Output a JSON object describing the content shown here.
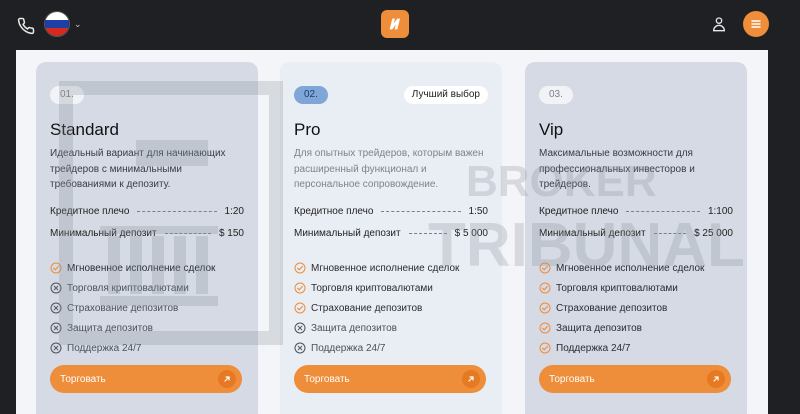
{
  "header": {
    "phone_icon": "phone-icon",
    "language_flag": "russia-flag-icon",
    "logo_icon": "broker-logo-icon",
    "user_icon": "user-icon",
    "menu_icon": "hamburger-menu-icon",
    "accent_color": "#ee8d3a"
  },
  "plans": [
    {
      "number": "01.",
      "title": "Standard",
      "description": "Идеальный вариант для начинающих трейдеров с минимальными требованиями к депозиту.",
      "specs": [
        {
          "label": "Кредитное плечо",
          "value": "1:20"
        },
        {
          "label": "Минимальный депозит",
          "value": "$ 150"
        }
      ],
      "features": [
        {
          "label": "Мгновенное исполнение сделок",
          "included": true
        },
        {
          "label": "Торговля криптовалютами",
          "included": false
        },
        {
          "label": "Страхование депозитов",
          "included": false
        },
        {
          "label": "Защита депозитов",
          "included": false
        },
        {
          "label": "Поддержка 24/7",
          "included": false
        }
      ],
      "button": "Торговать"
    },
    {
      "number": "02.",
      "badge": "Лучший выбор",
      "title": "Pro",
      "description": "Для опытных трейдеров, которым важен расширенный функционал и персональное сопровождение.",
      "specs": [
        {
          "label": "Кредитное плечо",
          "value": "1:50"
        },
        {
          "label": "Минимальный депозит",
          "value": "$ 5 000"
        }
      ],
      "features": [
        {
          "label": "Мгновенное исполнение сделок",
          "included": true
        },
        {
          "label": "Торговля криптовалютами",
          "included": true
        },
        {
          "label": "Страхование депозитов",
          "included": true
        },
        {
          "label": "Защита депозитов",
          "included": false
        },
        {
          "label": "Поддержка 24/7",
          "included": false
        }
      ],
      "button": "Торговать"
    },
    {
      "number": "03.",
      "title": "Vip",
      "description": "Максимальные возможности для профессиональных инвесторов и трейдеров.",
      "specs": [
        {
          "label": "Кредитное плечо",
          "value": "1:100"
        },
        {
          "label": "Минимальный депозит",
          "value": "$ 25 000"
        }
      ],
      "features": [
        {
          "label": "Мгновенное исполнение сделок",
          "included": true
        },
        {
          "label": "Торговля криптовалютами",
          "included": true
        },
        {
          "label": "Страхование депозитов",
          "included": true
        },
        {
          "label": "Защита депозитов",
          "included": true
        },
        {
          "label": "Поддержка 24/7",
          "included": true
        }
      ],
      "button": "Торговать"
    }
  ],
  "watermark": {
    "line1": "BROKER",
    "line2": "TRIBUNAL"
  }
}
